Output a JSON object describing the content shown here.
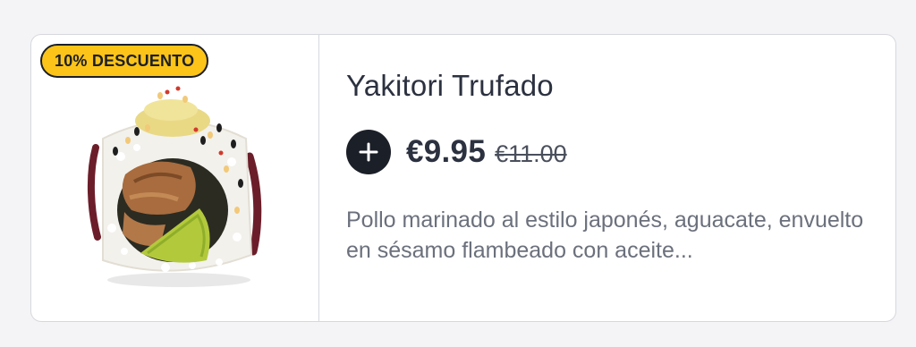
{
  "product": {
    "badge": "10% DESCUENTO",
    "title": "Yakitori Trufado",
    "price": "€9.95",
    "old_price": "€11.00",
    "description": "Pollo marinado al estilo japonés, aguacate, envuelto en sésamo flambeado con aceite...",
    "image_icon": "sushi-roll-image",
    "add_icon": "plus-icon"
  },
  "colors": {
    "badge_bg": "#fcc419",
    "button_bg": "#1b1f28",
    "text_primary": "#2c3140",
    "text_secondary": "#6b707c",
    "border": "#d6d8dd",
    "page_bg": "#f4f4f6"
  }
}
